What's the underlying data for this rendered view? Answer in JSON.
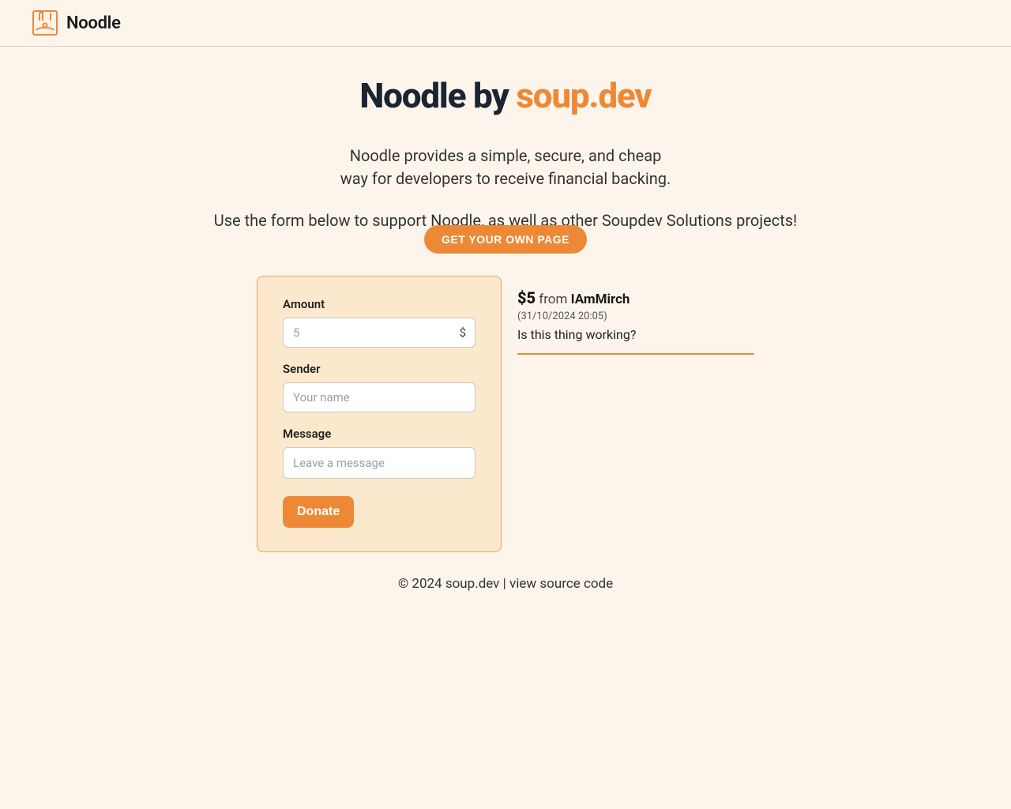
{
  "brand": {
    "name": "Noodle"
  },
  "hero": {
    "title_prefix": "Noodle by ",
    "title_accent": "soup.dev",
    "subtitle_l1": "Noodle provides a simple, secure, and cheap",
    "subtitle_l2": "way for developers to receive financial backing.",
    "cta_line": "Use the form below to support Noodle, as well as other Soupdev Solutions projects!",
    "cta_button": "GET YOUR OWN PAGE"
  },
  "form": {
    "amount_label": "Amount",
    "amount_placeholder": "5",
    "amount_value": "",
    "currency": "$",
    "sender_label": "Sender",
    "sender_placeholder": "Your name",
    "sender_value": "",
    "message_label": "Message",
    "message_placeholder": "Leave a message",
    "message_value": "",
    "submit": "Donate"
  },
  "feed": {
    "items": [
      {
        "amount": "$5",
        "from_word": "from",
        "sender": "IAmMirch",
        "timestamp": "(31/10/2024 20:05)",
        "message": "Is this thing working?"
      }
    ]
  },
  "footer": {
    "copyright": "© 2024 soup.dev",
    "sep": " | ",
    "source_link": "view source code"
  },
  "colors": {
    "accent": "#ed8936",
    "bg": "#fdf5ec",
    "card": "#fce8cd"
  }
}
